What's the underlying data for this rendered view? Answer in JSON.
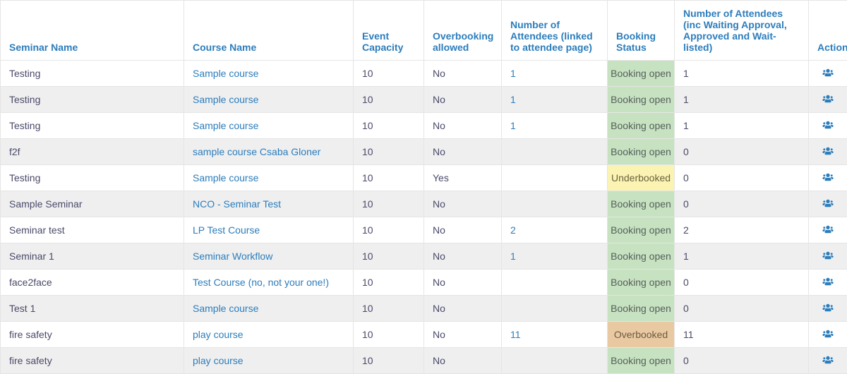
{
  "columns": {
    "seminar": "Seminar Name",
    "course": "Course Name",
    "capacity": "Event Capacity",
    "overbook": "Overbooking allowed",
    "linked": "Number of Attendees (linked to attendee page)",
    "status": "Booking Status",
    "incwait": "Number of Attendees (inc Waiting Approval, Approved and Wait-listed)",
    "actions": "Actions"
  },
  "status_labels": {
    "open": "Booking open",
    "under": "Underbooked",
    "over": "Overbooked"
  },
  "rows": [
    {
      "seminar": "Testing",
      "course": "Sample course",
      "capacity": "10",
      "overbook": "No",
      "linked": "1",
      "status": "open",
      "incwait": "1"
    },
    {
      "seminar": "Testing",
      "course": "Sample course",
      "capacity": "10",
      "overbook": "No",
      "linked": "1",
      "status": "open",
      "incwait": "1"
    },
    {
      "seminar": "Testing",
      "course": "Sample course",
      "capacity": "10",
      "overbook": "No",
      "linked": "1",
      "status": "open",
      "incwait": "1"
    },
    {
      "seminar": "f2f",
      "course": "sample course Csaba Gloner",
      "capacity": "10",
      "overbook": "No",
      "linked": "",
      "status": "open",
      "incwait": "0"
    },
    {
      "seminar": "Testing",
      "course": "Sample course",
      "capacity": "10",
      "overbook": "Yes",
      "linked": "",
      "status": "under",
      "incwait": "0"
    },
    {
      "seminar": "Sample Seminar",
      "course": "NCO - Seminar Test",
      "capacity": "10",
      "overbook": "No",
      "linked": "",
      "status": "open",
      "incwait": "0"
    },
    {
      "seminar": "Seminar test",
      "course": "LP Test Course",
      "capacity": "10",
      "overbook": "No",
      "linked": "2",
      "status": "open",
      "incwait": "2"
    },
    {
      "seminar": "Seminar 1",
      "course": "Seminar Workflow",
      "capacity": "10",
      "overbook": "No",
      "linked": "1",
      "status": "open",
      "incwait": "1"
    },
    {
      "seminar": "face2face",
      "course": "Test Course (no, not your one!)",
      "capacity": "10",
      "overbook": "No",
      "linked": "",
      "status": "open",
      "incwait": "0"
    },
    {
      "seminar": "Test 1",
      "course": "Sample course",
      "capacity": "10",
      "overbook": "No",
      "linked": "",
      "status": "open",
      "incwait": "0"
    },
    {
      "seminar": "fire safety",
      "course": "play course",
      "capacity": "10",
      "overbook": "No",
      "linked": "11",
      "status": "over",
      "incwait": "11"
    },
    {
      "seminar": "fire safety",
      "course": "play course",
      "capacity": "10",
      "overbook": "No",
      "linked": "",
      "status": "open",
      "incwait": "0"
    }
  ]
}
